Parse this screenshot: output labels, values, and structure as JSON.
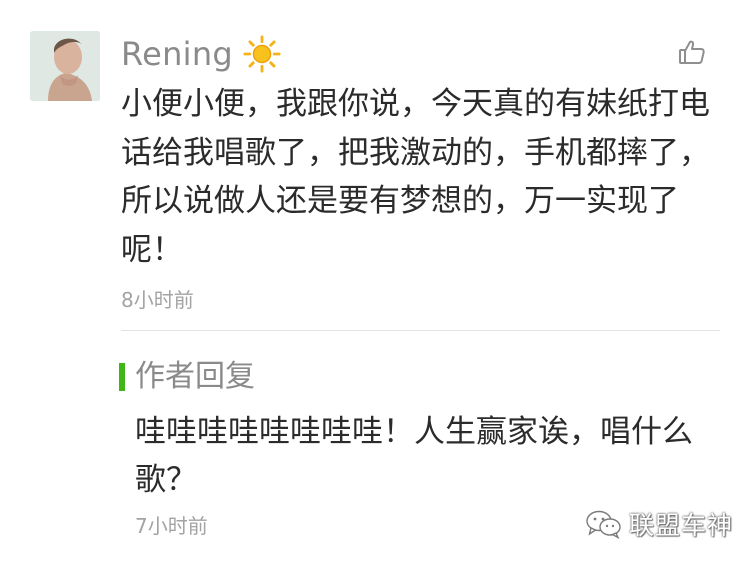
{
  "comment": {
    "username": "Rening",
    "text": "小便小便，我跟你说，今天真的有妹纸打电话给我唱歌了，把我激动的，手机都摔了，所以说做人还是要有梦想的，万一实现了呢！",
    "time": "8小时前"
  },
  "reply": {
    "heading": "作者回复",
    "text": "哇哇哇哇哇哇哇哇！人生赢家诶，唱什么歌？",
    "time": "7小时前"
  },
  "watermark": {
    "text": "联盟车神"
  },
  "icons": {
    "name_badge": "sun-icon",
    "like": "thumbs-up-icon",
    "watermark_logo": "wechat-icon"
  },
  "colors": {
    "reply_accent": "#3fb618",
    "secondary_text": "#8a8a8a",
    "sun": "#f7b500"
  }
}
